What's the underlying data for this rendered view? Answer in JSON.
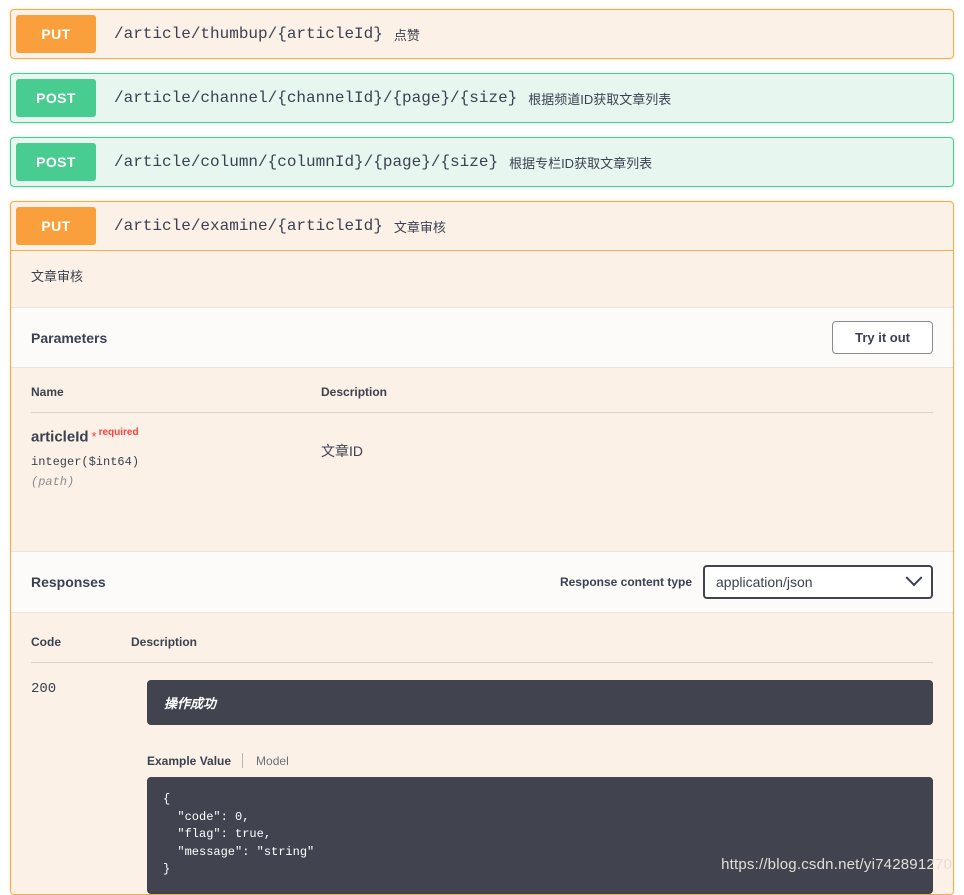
{
  "theme": {
    "put_color": "#f9a03c",
    "post_color": "#49cc90",
    "put_block_bg": "#fbf1e6",
    "post_block_bg": "#e8f6f0",
    "code_block_bg": "#41444e",
    "required_color": "#f93e3e",
    "text_color": "#3b4151"
  },
  "operations": [
    {
      "method": "PUT",
      "path": "/article/thumbup/{articleId}",
      "summary": "点赞",
      "expanded": false
    },
    {
      "method": "POST",
      "path": "/article/channel/{channelId}/{page}/{size}",
      "summary": "根据频道ID获取文章列表",
      "expanded": false
    },
    {
      "method": "POST",
      "path": "/article/column/{columnId}/{page}/{size}",
      "summary": "根据专栏ID获取文章列表",
      "expanded": false
    }
  ],
  "expanded_operation": {
    "method": "PUT",
    "path": "/article/examine/{articleId}",
    "summary": "文章审核",
    "description": "文章审核",
    "parameters_section": {
      "title": "Parameters",
      "try_it_out_label": "Try it out",
      "columns": {
        "name": "Name",
        "description": "Description"
      },
      "rows": [
        {
          "name": "articleId",
          "required_star": "*",
          "required_label": "required",
          "type": "integer($int64)",
          "in": "(path)",
          "description": "文章ID"
        }
      ]
    },
    "responses_section": {
      "title": "Responses",
      "content_type_label": "Response content type",
      "content_type_value": "application/json",
      "columns": {
        "code": "Code",
        "description": "Description"
      },
      "rows": [
        {
          "code": "200",
          "description": "操作成功",
          "example_tabs": {
            "active": "Example Value",
            "inactive": "Model"
          },
          "example_value": "{\n  \"code\": 0,\n  \"flag\": true,\n  \"message\": \"string\"\n}"
        }
      ]
    }
  },
  "watermark": "https://blog.csdn.net/yi742891270"
}
